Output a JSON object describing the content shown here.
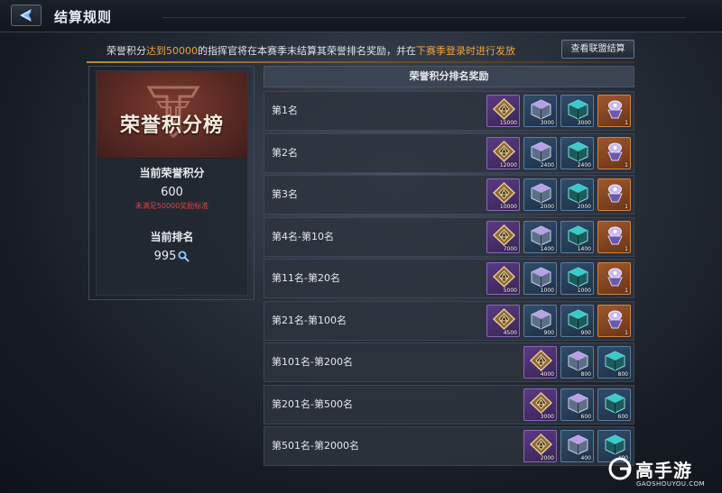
{
  "header": {
    "title": "结算规则"
  },
  "notice": {
    "part1": "荣誉积分",
    "highlight1": "达到50000",
    "part2": "的指挥官将在本赛季末结算其荣誉排名奖励，并在",
    "highlight2": "下赛季登录时进行发放",
    "alliance_button": "查看联盟结算"
  },
  "left_panel": {
    "banner_title": "荣誉积分榜",
    "score_label": "当前荣誉积分",
    "score_value": "600",
    "score_warning": "未满足50000奖励标准",
    "rank_label": "当前排名",
    "rank_value": "995"
  },
  "table": {
    "title": "荣誉积分排名奖励",
    "rows": [
      {
        "label": "第1名",
        "items": [
          {
            "icon": "honor-badge-icon",
            "rarity": "purple",
            "qty": "15000"
          },
          {
            "icon": "purple-crate-icon",
            "rarity": "blue",
            "qty": "3000"
          },
          {
            "icon": "teal-crate-icon",
            "rarity": "blue",
            "qty": "3000"
          },
          {
            "icon": "purple-gem-icon",
            "rarity": "orange",
            "qty": "1"
          }
        ]
      },
      {
        "label": "第2名",
        "items": [
          {
            "icon": "honor-badge-icon",
            "rarity": "purple",
            "qty": "12000"
          },
          {
            "icon": "purple-crate-icon",
            "rarity": "blue",
            "qty": "2400"
          },
          {
            "icon": "teal-crate-icon",
            "rarity": "blue",
            "qty": "2400"
          },
          {
            "icon": "purple-gem-icon",
            "rarity": "orange",
            "qty": "1"
          }
        ]
      },
      {
        "label": "第3名",
        "items": [
          {
            "icon": "honor-badge-icon",
            "rarity": "purple",
            "qty": "10000"
          },
          {
            "icon": "purple-crate-icon",
            "rarity": "blue",
            "qty": "2000"
          },
          {
            "icon": "teal-crate-icon",
            "rarity": "blue",
            "qty": "2000"
          },
          {
            "icon": "purple-gem-icon",
            "rarity": "orange",
            "qty": "1"
          }
        ]
      },
      {
        "label": "第4名-第10名",
        "items": [
          {
            "icon": "honor-badge-icon",
            "rarity": "purple",
            "qty": "7000"
          },
          {
            "icon": "purple-crate-icon",
            "rarity": "blue",
            "qty": "1400"
          },
          {
            "icon": "teal-crate-icon",
            "rarity": "blue",
            "qty": "1400"
          },
          {
            "icon": "purple-gem-icon",
            "rarity": "orange",
            "qty": "1"
          }
        ]
      },
      {
        "label": "第11名-第20名",
        "items": [
          {
            "icon": "honor-badge-icon",
            "rarity": "purple",
            "qty": "5000"
          },
          {
            "icon": "purple-crate-icon",
            "rarity": "blue",
            "qty": "1000"
          },
          {
            "icon": "teal-crate-icon",
            "rarity": "blue",
            "qty": "1000"
          },
          {
            "icon": "purple-gem-icon",
            "rarity": "orange",
            "qty": "1"
          }
        ]
      },
      {
        "label": "第21名-第100名",
        "items": [
          {
            "icon": "honor-badge-icon",
            "rarity": "purple",
            "qty": "4500"
          },
          {
            "icon": "purple-crate-icon",
            "rarity": "blue",
            "qty": "900"
          },
          {
            "icon": "teal-crate-icon",
            "rarity": "blue",
            "qty": "900"
          },
          {
            "icon": "purple-gem-icon",
            "rarity": "orange",
            "qty": "1"
          }
        ]
      },
      {
        "label": "第101名-第200名",
        "items": [
          {
            "icon": "honor-badge-icon",
            "rarity": "purple",
            "qty": "4000"
          },
          {
            "icon": "purple-crate-icon",
            "rarity": "blue",
            "qty": "800"
          },
          {
            "icon": "teal-crate-icon",
            "rarity": "blue",
            "qty": "800"
          }
        ]
      },
      {
        "label": "第201名-第500名",
        "items": [
          {
            "icon": "honor-badge-icon",
            "rarity": "purple",
            "qty": "3000"
          },
          {
            "icon": "purple-crate-icon",
            "rarity": "blue",
            "qty": "600"
          },
          {
            "icon": "teal-crate-icon",
            "rarity": "blue",
            "qty": "600"
          }
        ]
      },
      {
        "label": "第501名-第2000名",
        "items": [
          {
            "icon": "honor-badge-icon",
            "rarity": "purple",
            "qty": "2000"
          },
          {
            "icon": "purple-crate-icon",
            "rarity": "blue",
            "qty": "400"
          },
          {
            "icon": "teal-crate-icon",
            "rarity": "blue",
            "qty": "400"
          }
        ]
      }
    ]
  },
  "watermark": {
    "name": "高手游",
    "domain": "GAOSHOUYOU.COM"
  },
  "colors": {
    "highlight": "#f0a23a",
    "warning": "#e0453f",
    "banner": "#6b3028"
  }
}
